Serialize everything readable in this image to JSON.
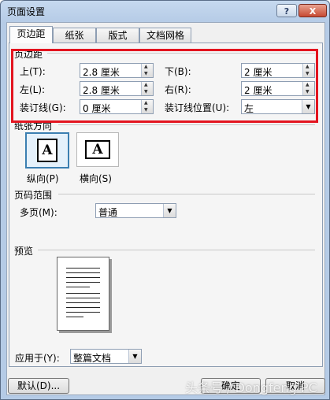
{
  "window": {
    "title": "页面设置",
    "help_label": "?",
    "close_label": "X"
  },
  "tabs": [
    {
      "label": "页边距"
    },
    {
      "label": "纸张"
    },
    {
      "label": "版式"
    },
    {
      "label": "文档网格"
    }
  ],
  "margins": {
    "group_label": "页边距",
    "top": {
      "label": "上(T):",
      "value": "2.8 厘米"
    },
    "bottom": {
      "label": "下(B):",
      "value": "2 厘米"
    },
    "left": {
      "label": "左(L):",
      "value": "2.8 厘米"
    },
    "right": {
      "label": "右(R):",
      "value": "2 厘米"
    },
    "gutter": {
      "label": "装订线(G):",
      "value": "0 厘米"
    },
    "gutter_position": {
      "label": "装订线位置(U):",
      "value": "左"
    }
  },
  "orientation": {
    "group_label": "纸张方向",
    "portrait": {
      "label": "纵向(P)",
      "glyph": "A"
    },
    "landscape": {
      "label": "横向(S)",
      "glyph": "A"
    }
  },
  "pages": {
    "group_label": "页码范围",
    "multiple_label": "多页(M):",
    "multiple_value": "普通"
  },
  "preview": {
    "group_label": "预览"
  },
  "apply_to": {
    "label": "应用于(Y):",
    "value": "整篇文档"
  },
  "buttons": {
    "default_label": "默认(D)...",
    "ok_label": "确定",
    "cancel_label": "取消"
  },
  "annotation": {
    "highlight_color": "#e3141f"
  },
  "watermark": {
    "text": "头条号 / Dongfeng PC"
  }
}
